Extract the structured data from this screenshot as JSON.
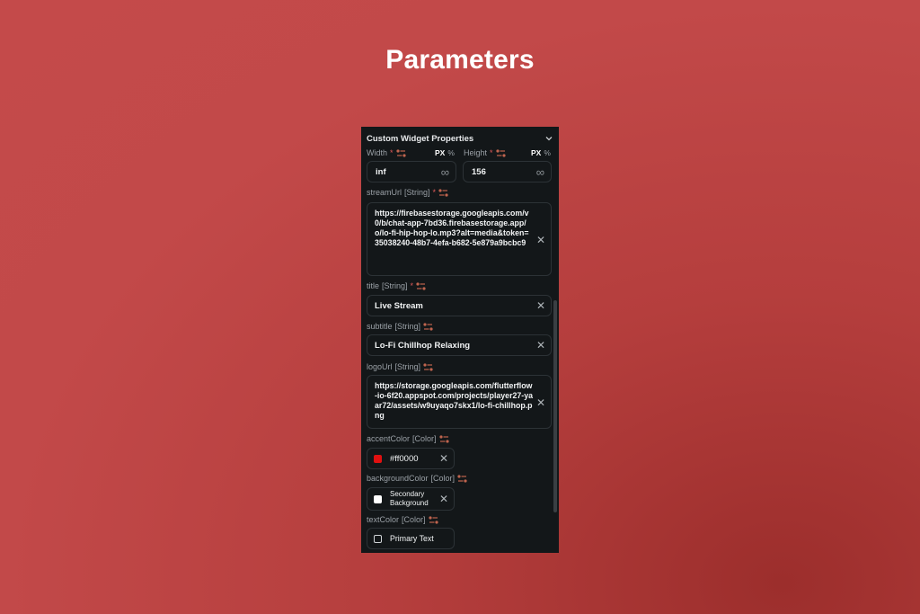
{
  "page": {
    "title": "Parameters"
  },
  "panel": {
    "header": "Custom Widget Properties",
    "width": {
      "label": "Width",
      "required": "*",
      "unit_px": "PX",
      "unit_pct": "%",
      "value": "inf"
    },
    "height": {
      "label": "Height",
      "required": "*",
      "unit_px": "PX",
      "unit_pct": "%",
      "value": "156"
    },
    "stream_url": {
      "label": "streamUrl",
      "type": "[String]",
      "required": "*",
      "value": "https://firebasestorage.googleapis.com/v0/b/chat-app-7bd36.firebasestorage.app/o/lo-fi-hip-hop-lo.mp3?alt=media&token=35038240-48b7-4efa-b682-5e879a9bcbc9"
    },
    "title": {
      "label": "title",
      "type": "[String]",
      "required": "*",
      "value": "Live Stream"
    },
    "subtitle": {
      "label": "subtitle",
      "type": "[String]",
      "value": "Lo-Fi Chillhop Relaxing"
    },
    "logo_url": {
      "label": "logoUrl",
      "type": "[String]",
      "value": "https://storage.googleapis.com/flutterflow-io-6f20.appspot.com/projects/player27-yaar72/assets/w9uyaqo7skx1/lo-fi-chillhop.png"
    },
    "accent_color": {
      "label": "accentColor",
      "type": "[Color]",
      "value": "#ff0000",
      "swatch": "#e01010"
    },
    "background_color": {
      "label": "backgroundColor",
      "type": "[Color]",
      "value_line1": "Secondary",
      "value_line2": "Background",
      "swatch": "#ffffff"
    },
    "text_color": {
      "label": "textColor",
      "type": "[Color]",
      "value": "Primary Text",
      "swatch": "#131719"
    },
    "clear_glyph": "✕",
    "infinity_glyph": "∞"
  },
  "colors": {
    "background": "#c24949",
    "panel": "#131719",
    "accent": "#ff0000"
  }
}
